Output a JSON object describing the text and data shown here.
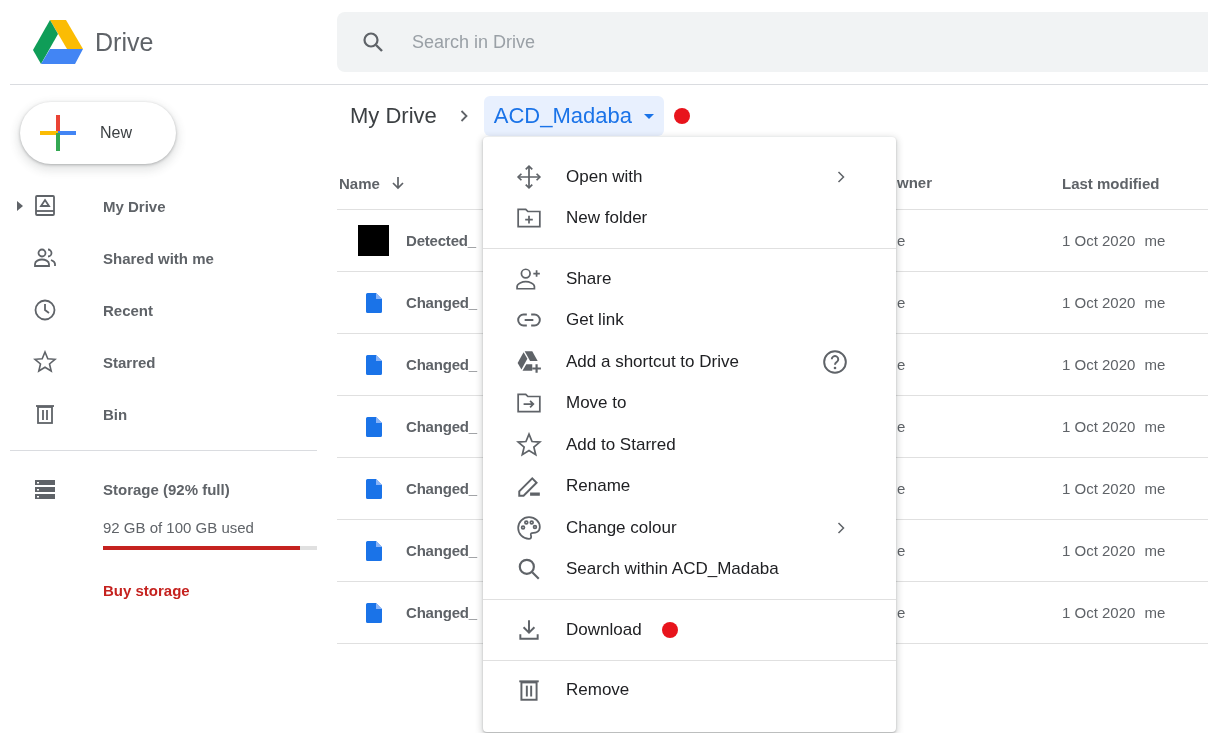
{
  "app": {
    "title": "Drive"
  },
  "search": {
    "placeholder": "Search in Drive"
  },
  "new_button": {
    "label": "New"
  },
  "sidebar": {
    "items": [
      {
        "label": "My Drive",
        "expandable": true
      },
      {
        "label": "Shared with me",
        "expandable": false
      },
      {
        "label": "Recent",
        "expandable": false
      },
      {
        "label": "Starred",
        "expandable": false
      },
      {
        "label": "Bin",
        "expandable": false
      }
    ]
  },
  "storage": {
    "label": "Storage (92% full)",
    "usage": "92 GB of 100 GB used",
    "level": 0.92,
    "link": "Buy storage"
  },
  "breadcrumb": {
    "root": "My Drive",
    "current": "ACD_Madaba",
    "marked": true
  },
  "table": {
    "columns": [
      "Name",
      "wner",
      "Last modified"
    ],
    "rows": [
      {
        "kind": "image",
        "name": "Detected_",
        "owner": "e",
        "modified": "1 Oct 2020",
        "modified_by": "me"
      },
      {
        "kind": "doc",
        "name": "Changed_",
        "owner": "e",
        "modified": "1 Oct 2020",
        "modified_by": "me"
      },
      {
        "kind": "doc",
        "name": "Changed_",
        "owner": "e",
        "modified": "1 Oct 2020",
        "modified_by": "me"
      },
      {
        "kind": "doc",
        "name": "Changed_",
        "owner": "e",
        "modified": "1 Oct 2020",
        "modified_by": "me"
      },
      {
        "kind": "doc",
        "name": "Changed_",
        "owner": "e",
        "modified": "1 Oct 2020",
        "modified_by": "me"
      },
      {
        "kind": "doc",
        "name": "Changed_",
        "owner": "e",
        "modified": "1 Oct 2020",
        "modified_by": "me"
      },
      {
        "kind": "doc",
        "name": "Changed_",
        "owner": "e",
        "modified": "1 Oct 2020",
        "modified_by": "me"
      }
    ]
  },
  "context_menu": {
    "sections": [
      [
        {
          "label": "Open with",
          "submenu": true,
          "help": false,
          "marked": false
        },
        {
          "label": "New folder",
          "submenu": false,
          "help": false,
          "marked": false
        }
      ],
      [
        {
          "label": "Share",
          "submenu": false,
          "help": false,
          "marked": false
        },
        {
          "label": "Get link",
          "submenu": false,
          "help": false,
          "marked": false
        },
        {
          "label": "Add a shortcut to Drive",
          "submenu": false,
          "help": true,
          "marked": false
        },
        {
          "label": "Move to",
          "submenu": false,
          "help": false,
          "marked": false
        },
        {
          "label": "Add to Starred",
          "submenu": false,
          "help": false,
          "marked": false
        },
        {
          "label": "Rename",
          "submenu": false,
          "help": false,
          "marked": false
        },
        {
          "label": "Change colour",
          "submenu": true,
          "help": false,
          "marked": false
        },
        {
          "label": "Search within ACD_Madaba",
          "submenu": false,
          "help": false,
          "marked": false
        }
      ],
      [
        {
          "label": "Download",
          "submenu": false,
          "help": false,
          "marked": true
        }
      ],
      [
        {
          "label": "Remove",
          "submenu": false,
          "help": false,
          "marked": false
        }
      ]
    ]
  }
}
